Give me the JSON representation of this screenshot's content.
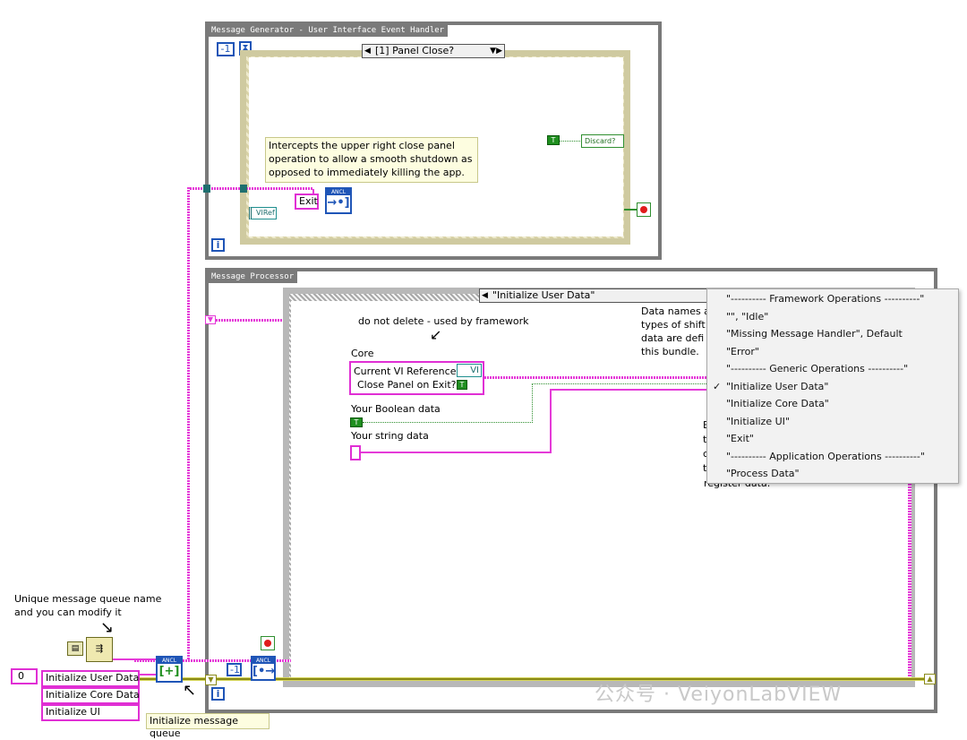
{
  "generator": {
    "title": "Message Generator - User Interface Event Handler",
    "timeout_value": "-1",
    "case_selector": "[1] Panel Close?",
    "note": "Intercepts the upper right close panel operation to allow a smooth shutdown as opposed to immediately killing the app.",
    "exit_constant": "Exit",
    "vi_ref_label": "VIRef",
    "discard_label": "Discard?",
    "true_glyph": "T",
    "enqueue_header": "ANCL",
    "enqueue_glyph": "→•]",
    "iteration_glyph": "i"
  },
  "processor": {
    "title": "Message Processor",
    "case_selector": "\"Initialize User Data\"",
    "do_not_delete_note": "do not delete - used by framework",
    "core_label": "Core",
    "cluster_items": [
      "Current VI Reference",
      "Close Panel on Exit?"
    ],
    "vi_glyph": "VI",
    "boolean_label": "Your Boolean data",
    "string_label": "Your string data",
    "data_names_note": [
      "Data names a",
      "types of shift",
      "data are defi",
      "this bundle."
    ],
    "partial_right_letters": [
      "E",
      "t",
      "c",
      "t"
    ],
    "partial_bottom_text": "register data.",
    "dequeue_value": "-1",
    "dequeue_header": "ANCL",
    "dequeue_glyph": "[•→",
    "iteration_glyph": "i"
  },
  "left": {
    "annotation_line1": "Unique message queue name",
    "annotation_line2": "and you can modify it",
    "array_index": "0",
    "array_items": [
      "Initialize User Data",
      "Initialize Core Data",
      "Initialize UI"
    ],
    "init_queue_header": "ANCL",
    "init_queue_glyph": "[+]",
    "init_queue_label": "Initialize message queue"
  },
  "menu": {
    "items": [
      {
        "label": "\"---------- Framework Operations ----------\"",
        "checked": false
      },
      {
        "label": "\"\", \"Idle\"",
        "checked": false
      },
      {
        "label": "\"Missing Message Handler\", Default",
        "checked": false
      },
      {
        "label": "\"Error\"",
        "checked": false
      },
      {
        "label": "\"---------- Generic Operations ----------\"",
        "checked": false
      },
      {
        "label": "\"Initialize User Data\"",
        "checked": true
      },
      {
        "label": "\"Initialize Core Data\"",
        "checked": false
      },
      {
        "label": "\"Initialize UI\"",
        "checked": false
      },
      {
        "label": "\"Exit\"",
        "checked": false
      },
      {
        "label": "\"---------- Application Operations ----------\"",
        "checked": false
      },
      {
        "label": "\"Process Data\"",
        "checked": false
      }
    ],
    "check_glyph": "✓"
  },
  "watermark": "公众号 · VeiyonLabVIEW",
  "colors": {
    "queue_wire": "#e53ad8",
    "boolean_wire": "#2f8f2f",
    "error_wire": "#8a8a1a",
    "refnum_blue": "#1f55b7",
    "loop_gray": "#7a7a7a"
  }
}
